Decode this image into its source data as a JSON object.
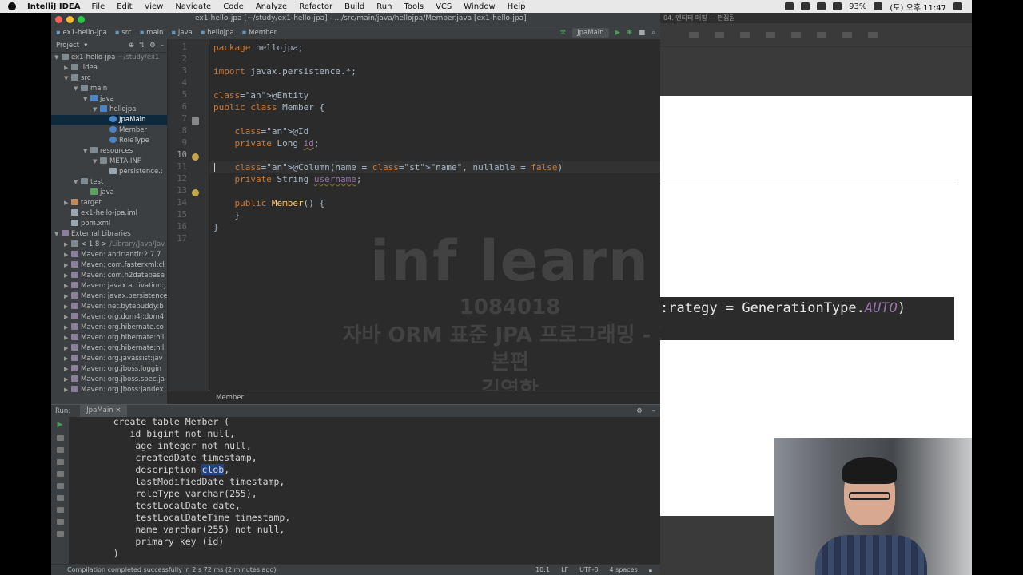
{
  "menubar": {
    "app": "IntelliJ IDEA",
    "items": [
      "File",
      "Edit",
      "View",
      "Navigate",
      "Code",
      "Analyze",
      "Refactor",
      "Build",
      "Run",
      "Tools",
      "VCS",
      "Window",
      "Help"
    ],
    "battery": "93%",
    "clock": "(토) 오후 11:47"
  },
  "window": {
    "title": "ex1-hello-jpa [~/study/ex1-hello-jpa] - .../src/main/java/hellojpa/Member.java [ex1-hello-jpa]"
  },
  "navbar": {
    "crumbs": [
      "ex1-hello-jpa",
      "src",
      "main",
      "java",
      "hellojpa",
      "Member"
    ],
    "run_config": "JpaMain"
  },
  "project": {
    "header": "Project",
    "tree": [
      {
        "label": "ex1-hello-jpa",
        "extra": "~/study/ex1",
        "icon": "folder",
        "arrow": "▼",
        "depth": 0
      },
      {
        "label": ".idea",
        "icon": "folder",
        "arrow": "▶",
        "depth": 1
      },
      {
        "label": "src",
        "icon": "folder",
        "arrow": "▼",
        "depth": 1
      },
      {
        "label": "main",
        "icon": "folder",
        "arrow": "▼",
        "depth": 2
      },
      {
        "label": "java",
        "icon": "src",
        "arrow": "▼",
        "depth": 3
      },
      {
        "label": "hellojpa",
        "icon": "src",
        "arrow": "▼",
        "depth": 4
      },
      {
        "label": "JpaMain",
        "icon": "cls",
        "arrow": "",
        "depth": 5,
        "selected": true
      },
      {
        "label": "Member",
        "icon": "cls",
        "arrow": "",
        "depth": 5
      },
      {
        "label": "RoleType",
        "icon": "cls",
        "arrow": "",
        "depth": 5
      },
      {
        "label": "resources",
        "icon": "folder",
        "arrow": "▼",
        "depth": 3
      },
      {
        "label": "META-INF",
        "icon": "folder",
        "arrow": "▼",
        "depth": 4
      },
      {
        "label": "persistence.:",
        "icon": "file",
        "arrow": "",
        "depth": 5
      },
      {
        "label": "test",
        "icon": "folder",
        "arrow": "▼",
        "depth": 2
      },
      {
        "label": "java",
        "icon": "test",
        "arrow": "",
        "depth": 3
      },
      {
        "label": "target",
        "icon": "target",
        "arrow": "▶",
        "depth": 1
      },
      {
        "label": "ex1-hello-jpa.iml",
        "icon": "file",
        "arrow": "",
        "depth": 1
      },
      {
        "label": "pom.xml",
        "icon": "file",
        "arrow": "",
        "depth": 1
      },
      {
        "label": "External Libraries",
        "icon": "lib",
        "arrow": "▼",
        "depth": 0
      },
      {
        "label": "< 1.8 >",
        "extra": "/Library/Java/Jav",
        "icon": "folder",
        "arrow": "▶",
        "depth": 1
      },
      {
        "label": "Maven: antlr:antlr:2.7.7",
        "icon": "lib",
        "arrow": "▶",
        "depth": 1
      },
      {
        "label": "Maven: com.fasterxml:cl",
        "icon": "lib",
        "arrow": "▶",
        "depth": 1
      },
      {
        "label": "Maven: com.h2database",
        "icon": "lib",
        "arrow": "▶",
        "depth": 1
      },
      {
        "label": "Maven: javax.activation:j",
        "icon": "lib",
        "arrow": "▶",
        "depth": 1
      },
      {
        "label": "Maven: javax.persistence",
        "icon": "lib",
        "arrow": "▶",
        "depth": 1
      },
      {
        "label": "Maven: net.bytebuddy:b",
        "icon": "lib",
        "arrow": "▶",
        "depth": 1
      },
      {
        "label": "Maven: org.dom4j:dom4",
        "icon": "lib",
        "arrow": "▶",
        "depth": 1
      },
      {
        "label": "Maven: org.hibernate.co",
        "icon": "lib",
        "arrow": "▶",
        "depth": 1
      },
      {
        "label": "Maven: org.hibernate:hil",
        "icon": "lib",
        "arrow": "▶",
        "depth": 1
      },
      {
        "label": "Maven: org.hibernate:hil",
        "icon": "lib",
        "arrow": "▶",
        "depth": 1
      },
      {
        "label": "Maven: org.javassist:jav",
        "icon": "lib",
        "arrow": "▶",
        "depth": 1
      },
      {
        "label": "Maven: org.jboss.loggin",
        "icon": "lib",
        "arrow": "▶",
        "depth": 1
      },
      {
        "label": "Maven: org.jboss.spec.ja",
        "icon": "lib",
        "arrow": "▶",
        "depth": 1
      },
      {
        "label": "Maven: org.jboss:jandex",
        "icon": "lib",
        "arrow": "▶",
        "depth": 1
      }
    ]
  },
  "editor": {
    "line_numbers": [
      "1",
      "2",
      "3",
      "4",
      "5",
      "6",
      "7",
      "8",
      "9",
      "10",
      "11",
      "12",
      "13",
      "14",
      "15",
      "16",
      "17"
    ],
    "current_line": "10",
    "lines": [
      "package hellojpa;",
      "",
      "import javax.persistence.*;",
      "",
      "@Entity",
      "public class Member {",
      "",
      "    @Id",
      "    private Long id;",
      "",
      "    @Column(name = \"name\", nullable = false)",
      "    private String username;",
      "",
      "    public Member() {",
      "    }",
      "}",
      ""
    ],
    "breadcrumb": "Member"
  },
  "watermark": {
    "brand": "inf learn",
    "id": "1084018",
    "course": "자바 ORM 표준 JPA 프로그래밍 - 기본편",
    "author": "김영한"
  },
  "run": {
    "label": "Run:",
    "tab": "JpaMain",
    "console": [
      "    create table Member (",
      "       id bigint not null,",
      "        age integer not null,",
      "        createdDate timestamp,",
      "        description clob,",
      "        lastModifiedDate timestamp,",
      "        roleType varchar(255),",
      "        testLocalDate date,",
      "        testLocalDateTime timestamp,",
      "        name varchar(255) not null,",
      "        primary key (id)",
      "    )"
    ]
  },
  "statusbar": {
    "message": "Compilation completed successfully in 2 s 72 ms (2 minutes ago)",
    "position": "10:1",
    "line_sep": "LF",
    "encoding": "UTF-8",
    "indent": "4 spaces"
  },
  "slides": {
    "tab": "04. 엔티티 매핑 — 편집됨",
    "code_prefix": ":rategy = GenerationType.",
    "code_italic": "AUTO",
    "code_suffix": ")"
  },
  "colors": {
    "keyword": "#cc7832",
    "annotation": "#bbb529",
    "string": "#6a8759",
    "method": "#ffc66d",
    "field": "#9876aa",
    "text": "#a9b7c6"
  }
}
